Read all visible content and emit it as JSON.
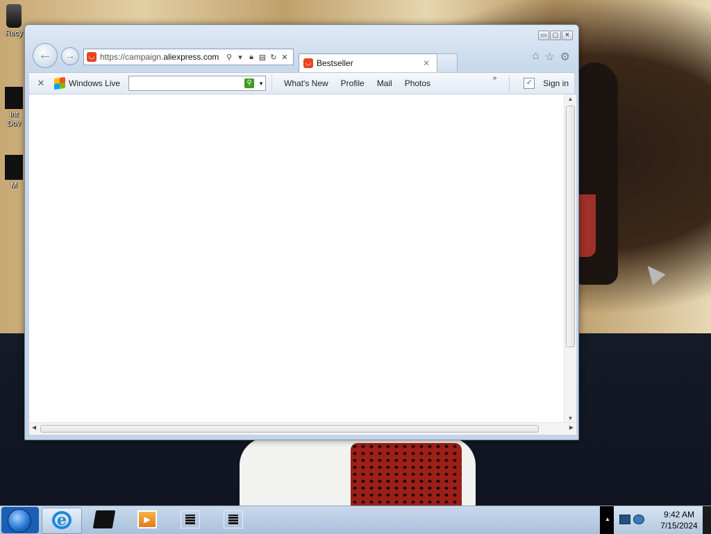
{
  "desktop": {
    "icons": [
      {
        "label": "Recy"
      },
      {
        "label": "Int Dov"
      },
      {
        "label": "M"
      }
    ]
  },
  "browser": {
    "address": {
      "prefix": "https://campaign.",
      "domain": "aliexpress.com"
    },
    "tab": {
      "label": "Bestseller"
    },
    "window_controls": {
      "minimize": "▭",
      "maximize": "▢",
      "close": "✕"
    },
    "commandbar": {
      "close_label": "✕",
      "brand_label": "Windows Live",
      "search_value": "",
      "links": [
        "What's New",
        "Profile",
        "Mail",
        "Photos"
      ],
      "more": "»",
      "signin": "Sign in"
    }
  },
  "taskbar": {
    "clock": {
      "time": "9:42 AM",
      "date": "7/15/2024"
    }
  },
  "colors": {
    "accent": "#e8431f",
    "search_go": "#3f9a1f",
    "ie_blue": "#1e88d8"
  }
}
